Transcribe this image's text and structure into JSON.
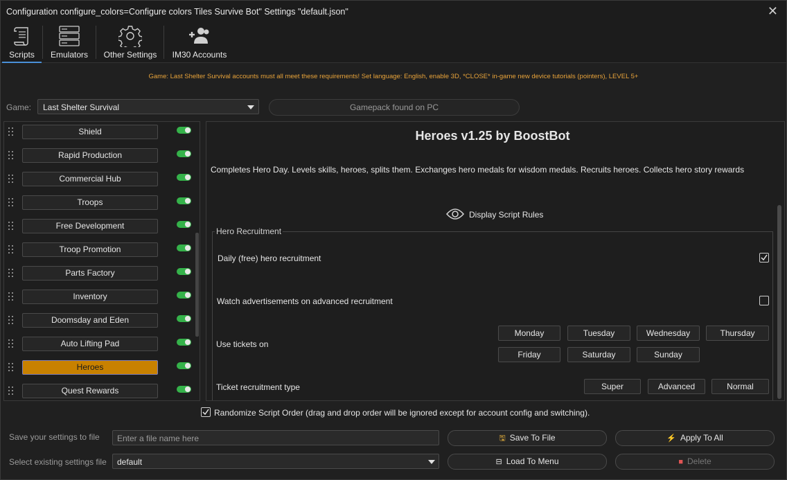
{
  "window": {
    "title": "Configuration configure_colors=Configure colors Tiles Survive Bot\" Settings \"default.json\"",
    "close_glyph": "✕"
  },
  "tabs": [
    {
      "label": "Scripts",
      "icon": "scroll-icon",
      "active": true
    },
    {
      "label": "Emulators",
      "icon": "server-stack-icon"
    },
    {
      "label": "Other Settings",
      "icon": "gear-icon"
    },
    {
      "label": "IM30 Accounts",
      "icon": "users-add-icon"
    }
  ],
  "notice": "Game: Last Shelter Survival accounts must all meet these requirements! Set language: English, enable 3D, *CLOSE* in-game new device tutorials (pointers), LEVEL 5+",
  "game": {
    "label": "Game:",
    "selected": "Last Shelter Survival",
    "gamepack_status": "Gamepack found on PC"
  },
  "scripts": [
    {
      "label": "Shield",
      "enabled": true
    },
    {
      "label": "Rapid Production",
      "enabled": true
    },
    {
      "label": "Commercial Hub",
      "enabled": true
    },
    {
      "label": "Troops",
      "enabled": true
    },
    {
      "label": "Free Development",
      "enabled": true
    },
    {
      "label": "Troop Promotion",
      "enabled": true
    },
    {
      "label": "Parts Factory",
      "enabled": true
    },
    {
      "label": "Inventory",
      "enabled": true
    },
    {
      "label": "Doomsday and Eden",
      "enabled": true
    },
    {
      "label": "Auto Lifting Pad",
      "enabled": true
    },
    {
      "label": "Heroes",
      "enabled": true,
      "selected": true
    },
    {
      "label": "Quest Rewards",
      "enabled": true
    }
  ],
  "detail": {
    "title": "Heroes v1.25 by BoostBot",
    "description": "Completes Hero Day. Levels skills, heroes, splits them. Exchanges hero medals for wisdom medals. Recruits heroes. Collects hero story rewards",
    "rules_label": "Display Script Rules",
    "group_title": "Hero Recruitment",
    "daily_free_label": "Daily (free) hero recruitment",
    "daily_free_checked": true,
    "watch_ads_label": "Watch advertisements on advanced recruitment",
    "watch_ads_checked": false,
    "tickets_label": "Use tickets on",
    "days": [
      "Monday",
      "Tuesday",
      "Wednesday",
      "Thursday",
      "Friday",
      "Saturday",
      "Sunday"
    ],
    "ticket_type_label": "Ticket recruitment type",
    "ticket_types": [
      "Super",
      "Advanced",
      "Normal"
    ]
  },
  "randomize": {
    "label": "Randomize Script Order (drag and drop order will be ignored except for account config and switching).",
    "checked": true
  },
  "footer": {
    "save_label": "Save your settings to file",
    "save_placeholder": "Enter a file name here",
    "select_label": "Select existing settings file",
    "select_value": "default",
    "save_to_file": "Save To File",
    "apply_to_all": "Apply To All",
    "load_to_menu": "Load To Menu",
    "delete": "Delete"
  },
  "colors": {
    "accent_orange": "#c88100",
    "toggle_green": "#35b24a",
    "notice_orange": "#e8a33a",
    "delete_red": "#e25555",
    "tab_underline": "#4a90d9"
  }
}
